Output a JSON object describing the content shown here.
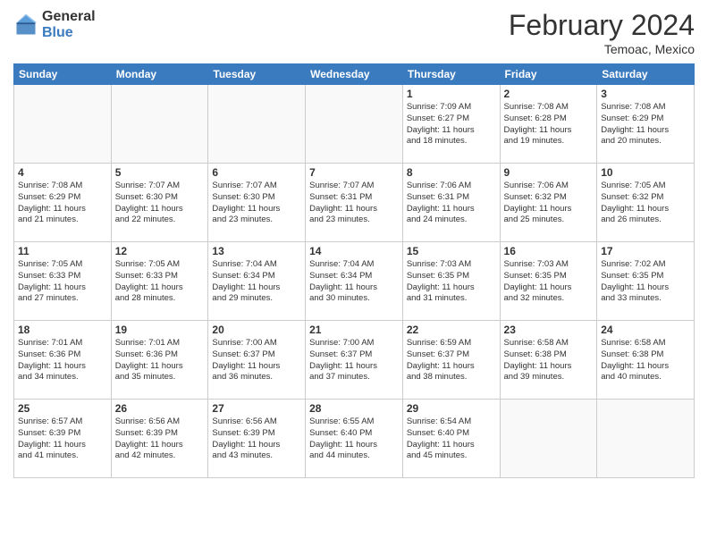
{
  "header": {
    "logo_general": "General",
    "logo_blue": "Blue",
    "month_title": "February 2024",
    "location": "Temoac, Mexico"
  },
  "days_of_week": [
    "Sunday",
    "Monday",
    "Tuesday",
    "Wednesday",
    "Thursday",
    "Friday",
    "Saturday"
  ],
  "weeks": [
    [
      {
        "day": "",
        "info": ""
      },
      {
        "day": "",
        "info": ""
      },
      {
        "day": "",
        "info": ""
      },
      {
        "day": "",
        "info": ""
      },
      {
        "day": "1",
        "info": "Sunrise: 7:09 AM\nSunset: 6:27 PM\nDaylight: 11 hours\nand 18 minutes."
      },
      {
        "day": "2",
        "info": "Sunrise: 7:08 AM\nSunset: 6:28 PM\nDaylight: 11 hours\nand 19 minutes."
      },
      {
        "day": "3",
        "info": "Sunrise: 7:08 AM\nSunset: 6:29 PM\nDaylight: 11 hours\nand 20 minutes."
      }
    ],
    [
      {
        "day": "4",
        "info": "Sunrise: 7:08 AM\nSunset: 6:29 PM\nDaylight: 11 hours\nand 21 minutes."
      },
      {
        "day": "5",
        "info": "Sunrise: 7:07 AM\nSunset: 6:30 PM\nDaylight: 11 hours\nand 22 minutes."
      },
      {
        "day": "6",
        "info": "Sunrise: 7:07 AM\nSunset: 6:30 PM\nDaylight: 11 hours\nand 23 minutes."
      },
      {
        "day": "7",
        "info": "Sunrise: 7:07 AM\nSunset: 6:31 PM\nDaylight: 11 hours\nand 23 minutes."
      },
      {
        "day": "8",
        "info": "Sunrise: 7:06 AM\nSunset: 6:31 PM\nDaylight: 11 hours\nand 24 minutes."
      },
      {
        "day": "9",
        "info": "Sunrise: 7:06 AM\nSunset: 6:32 PM\nDaylight: 11 hours\nand 25 minutes."
      },
      {
        "day": "10",
        "info": "Sunrise: 7:05 AM\nSunset: 6:32 PM\nDaylight: 11 hours\nand 26 minutes."
      }
    ],
    [
      {
        "day": "11",
        "info": "Sunrise: 7:05 AM\nSunset: 6:33 PM\nDaylight: 11 hours\nand 27 minutes."
      },
      {
        "day": "12",
        "info": "Sunrise: 7:05 AM\nSunset: 6:33 PM\nDaylight: 11 hours\nand 28 minutes."
      },
      {
        "day": "13",
        "info": "Sunrise: 7:04 AM\nSunset: 6:34 PM\nDaylight: 11 hours\nand 29 minutes."
      },
      {
        "day": "14",
        "info": "Sunrise: 7:04 AM\nSunset: 6:34 PM\nDaylight: 11 hours\nand 30 minutes."
      },
      {
        "day": "15",
        "info": "Sunrise: 7:03 AM\nSunset: 6:35 PM\nDaylight: 11 hours\nand 31 minutes."
      },
      {
        "day": "16",
        "info": "Sunrise: 7:03 AM\nSunset: 6:35 PM\nDaylight: 11 hours\nand 32 minutes."
      },
      {
        "day": "17",
        "info": "Sunrise: 7:02 AM\nSunset: 6:35 PM\nDaylight: 11 hours\nand 33 minutes."
      }
    ],
    [
      {
        "day": "18",
        "info": "Sunrise: 7:01 AM\nSunset: 6:36 PM\nDaylight: 11 hours\nand 34 minutes."
      },
      {
        "day": "19",
        "info": "Sunrise: 7:01 AM\nSunset: 6:36 PM\nDaylight: 11 hours\nand 35 minutes."
      },
      {
        "day": "20",
        "info": "Sunrise: 7:00 AM\nSunset: 6:37 PM\nDaylight: 11 hours\nand 36 minutes."
      },
      {
        "day": "21",
        "info": "Sunrise: 7:00 AM\nSunset: 6:37 PM\nDaylight: 11 hours\nand 37 minutes."
      },
      {
        "day": "22",
        "info": "Sunrise: 6:59 AM\nSunset: 6:37 PM\nDaylight: 11 hours\nand 38 minutes."
      },
      {
        "day": "23",
        "info": "Sunrise: 6:58 AM\nSunset: 6:38 PM\nDaylight: 11 hours\nand 39 minutes."
      },
      {
        "day": "24",
        "info": "Sunrise: 6:58 AM\nSunset: 6:38 PM\nDaylight: 11 hours\nand 40 minutes."
      }
    ],
    [
      {
        "day": "25",
        "info": "Sunrise: 6:57 AM\nSunset: 6:39 PM\nDaylight: 11 hours\nand 41 minutes."
      },
      {
        "day": "26",
        "info": "Sunrise: 6:56 AM\nSunset: 6:39 PM\nDaylight: 11 hours\nand 42 minutes."
      },
      {
        "day": "27",
        "info": "Sunrise: 6:56 AM\nSunset: 6:39 PM\nDaylight: 11 hours\nand 43 minutes."
      },
      {
        "day": "28",
        "info": "Sunrise: 6:55 AM\nSunset: 6:40 PM\nDaylight: 11 hours\nand 44 minutes."
      },
      {
        "day": "29",
        "info": "Sunrise: 6:54 AM\nSunset: 6:40 PM\nDaylight: 11 hours\nand 45 minutes."
      },
      {
        "day": "",
        "info": ""
      },
      {
        "day": "",
        "info": ""
      }
    ]
  ]
}
